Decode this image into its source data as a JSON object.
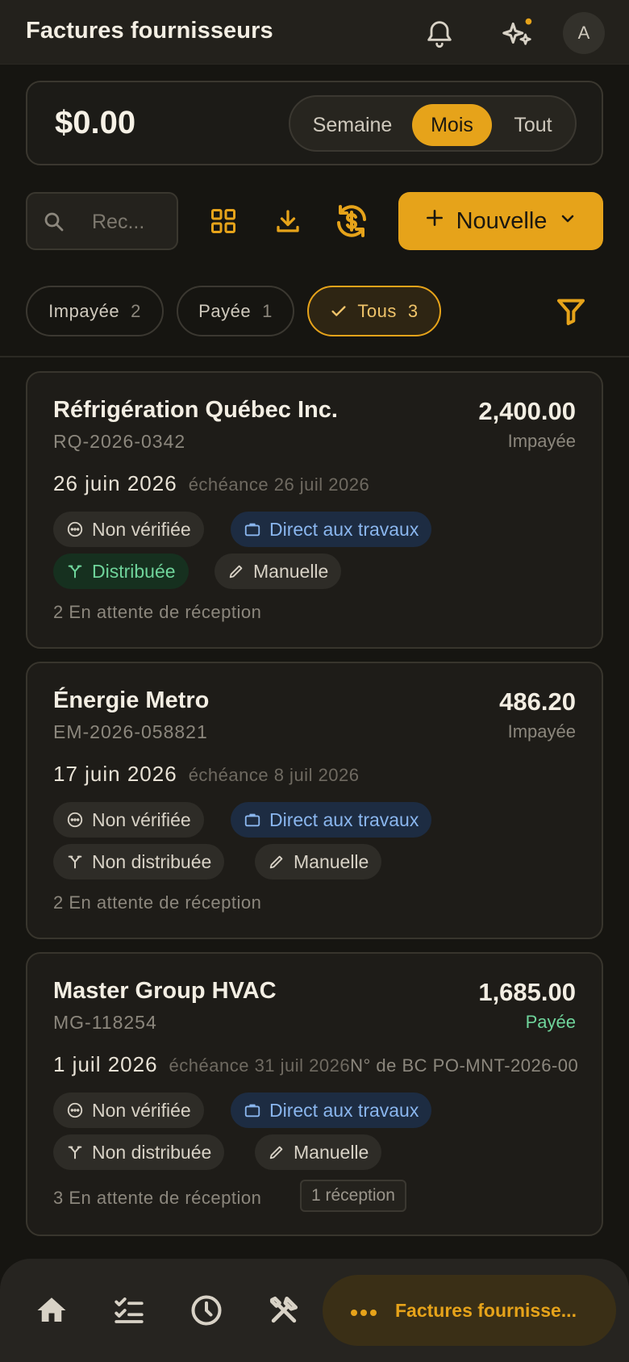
{
  "header": {
    "title": "Factures fournisseurs",
    "avatar_initial": "A",
    "icons": [
      "bell-icon",
      "sparkles-icon"
    ]
  },
  "summary": {
    "total": "$0.00",
    "periods": [
      "Semaine",
      "Mois",
      "Tout"
    ],
    "selected_period": "Mois"
  },
  "toolbar": {
    "search_placeholder": "Rec...",
    "new_label": "Nouvelle",
    "icons": [
      "grid-icon",
      "download-icon",
      "sync-dollar-icon",
      "plus-icon",
      "chevron-down-icon"
    ]
  },
  "filters": {
    "chips": [
      {
        "label": "Impayée",
        "count": "2"
      },
      {
        "label": "Payée",
        "count": "1"
      },
      {
        "label": "Tous",
        "count": "3",
        "active": true
      }
    ]
  },
  "invoices": [
    {
      "vendor": "Réfrigération Québec Inc.",
      "ref": "RQ-2026-0342",
      "amount": "2,400.00",
      "status": "Impayée",
      "date": "26 juin 2026",
      "due": "échéance 26 juil 2026",
      "po": "",
      "tags": {
        "verify": "Non vérifiée",
        "direct": "Direct aux travaux",
        "distrib": "Distribuée",
        "manual": "Manuelle"
      },
      "note": "2 En attente de réception",
      "receipt": ""
    },
    {
      "vendor": "Énergie Metro",
      "ref": "EM-2026-058821",
      "amount": "486.20",
      "status": "Impayée",
      "date": "17 juin 2026",
      "due": "échéance 8 juil 2026",
      "po": "",
      "tags": {
        "verify": "Non vérifiée",
        "direct": "Direct aux travaux",
        "distrib": "Non distribuée",
        "manual": "Manuelle"
      },
      "note": "2 En attente de réception",
      "receipt": ""
    },
    {
      "vendor": "Master Group HVAC",
      "ref": "MG-118254",
      "amount": "1,685.00",
      "status": "Payée",
      "date": "1 juil 2026",
      "due": "échéance 31 juil 2026",
      "po": "N° de BC PO-MNT-2026-00",
      "tags": {
        "verify": "Non vérifiée",
        "direct": "Direct aux travaux",
        "distrib": "Non distribuée",
        "manual": "Manuelle"
      },
      "note": "3 En attente de réception",
      "receipt": "1 réception"
    }
  ],
  "bottom_nav": {
    "active_label": "Factures fournisse...",
    "icons": [
      "home-icon",
      "checklist-icon",
      "clock-icon",
      "tools-icon",
      "more-icon"
    ]
  },
  "colors": {
    "accent": "#e6a31a",
    "background": "#161511",
    "card": "#1e1c18",
    "paid": "#6fd49b",
    "link_blue": "#8ab6ee"
  }
}
